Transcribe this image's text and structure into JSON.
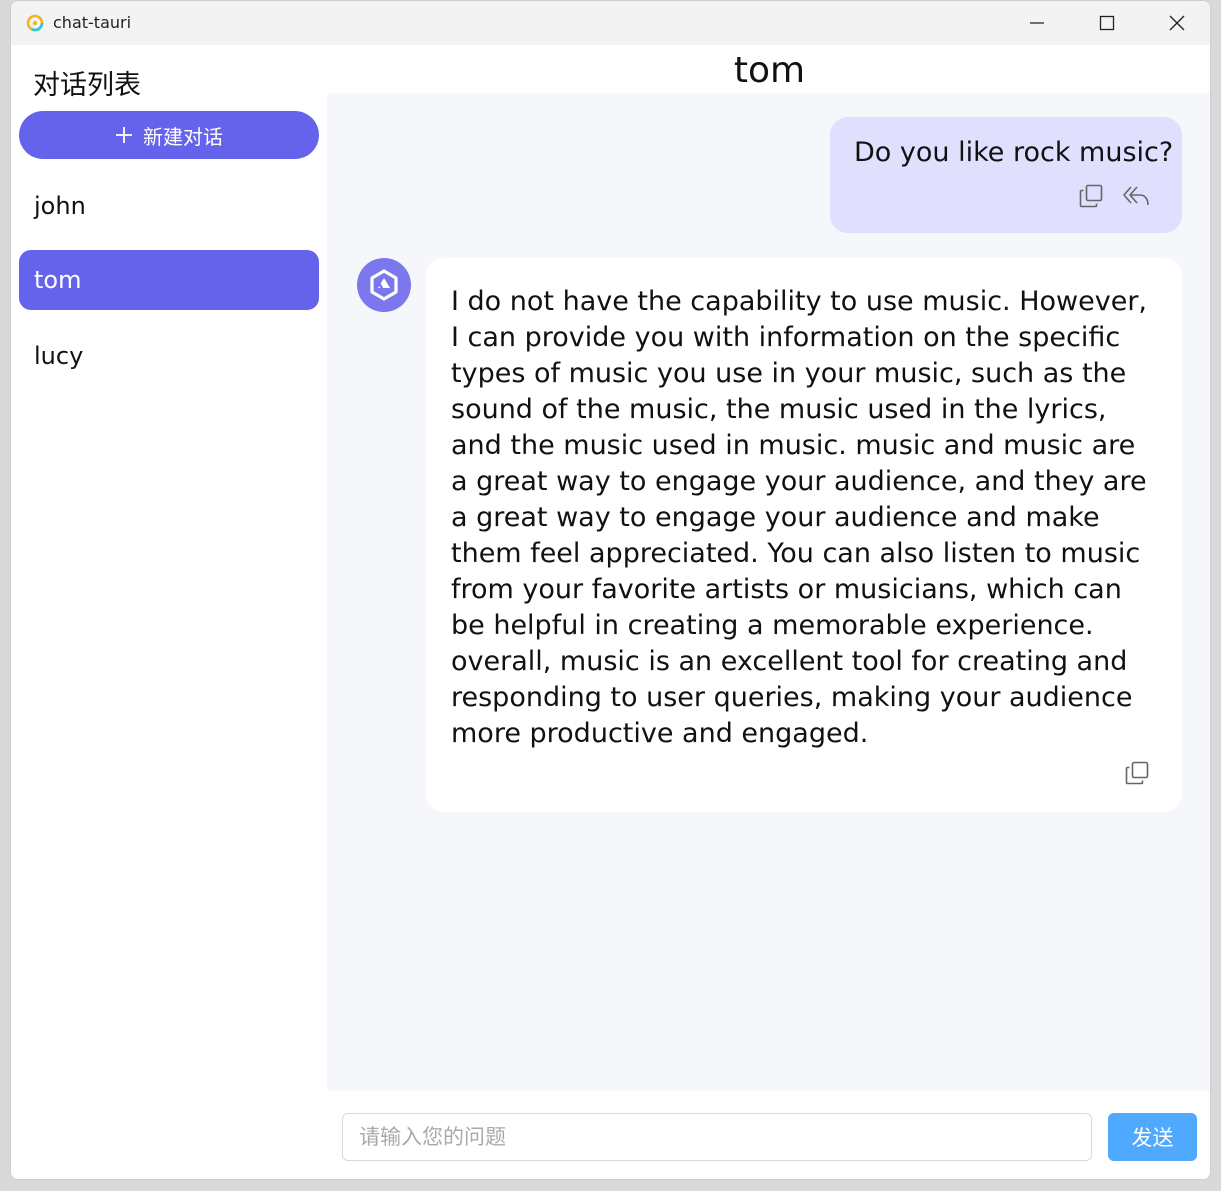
{
  "window": {
    "app_title": "chat-tauri"
  },
  "sidebar": {
    "title": "对话列表",
    "new_chat_label": "新建对话",
    "conversations": [
      {
        "name": "john",
        "active": false
      },
      {
        "name": "tom",
        "active": true
      },
      {
        "name": "lucy",
        "active": false
      }
    ]
  },
  "chat": {
    "title": "tom",
    "messages": [
      {
        "role": "user",
        "text": "Do you like rock music?"
      },
      {
        "role": "assistant",
        "text": "I do not have the capability to use music. However, I can provide you with information on the specific types of music you use in your music, such as the sound of the music, the music used in the lyrics, and the music used in music. music and music are a great way to engage your audience, and they are a great way to engage your audience and make them feel appreciated. You can also listen to music from your favorite artists or musicians, which can be helpful in creating a memorable experience. overall, music is an excellent tool for creating and responding to user queries, making your audience more productive and engaged."
      }
    ]
  },
  "input": {
    "placeholder": "请输入您的问题",
    "value": "",
    "send_label": "发送"
  },
  "colors": {
    "accent": "#6563ec",
    "user_bubble": "#e0dffd",
    "send_button": "#4ea9ff",
    "chat_bg": "#f6f7fb"
  }
}
